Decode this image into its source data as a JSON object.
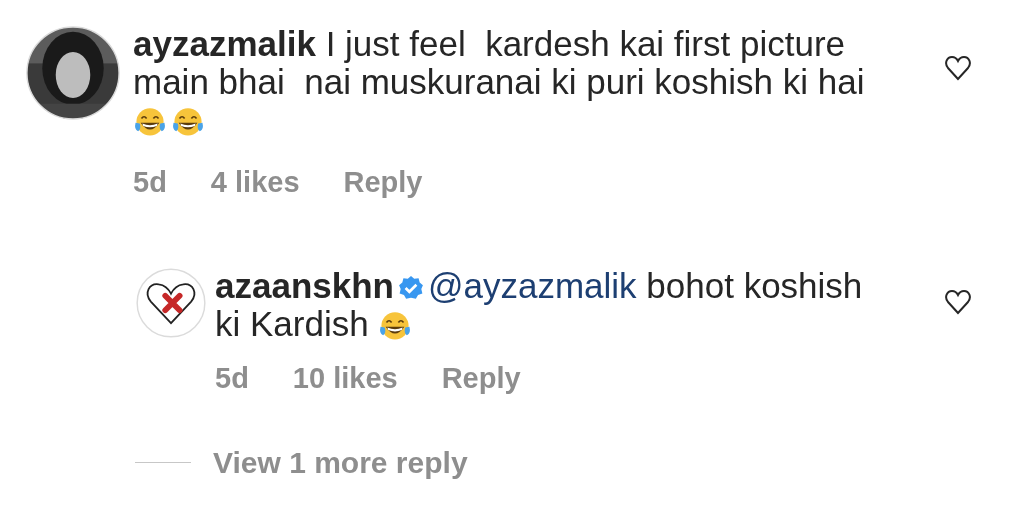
{
  "comments": [
    {
      "username": "ayzazmalik",
      "verified": false,
      "avatar": {
        "kind": "picture"
      },
      "lines": [
        "I just feel  kardesh kai first picture",
        "main bhai  nai muskuranai ki puri koshish ki hai"
      ],
      "emoji": [
        {
          "kind": "tears-of-joy"
        },
        {
          "kind": "tears-of-joy"
        }
      ],
      "emoji_inline": false,
      "liked": false,
      "age": "5d",
      "likes": "4 likes",
      "reply_label": "Reply",
      "replies": [
        {
          "username": "azaanskhn",
          "verified": true,
          "avatar": {
            "kind": "broken-heart"
          },
          "mention": "@ayzazmalik",
          "lines": [
            " bohot koshish",
            "ki Kardish"
          ],
          "emoji": [
            {
              "kind": "tears-of-joy"
            }
          ],
          "emoji_inline": true,
          "liked": false,
          "age": "5d",
          "likes": "10 likes",
          "reply_label": "Reply"
        }
      ],
      "more_replies": "View 1 more reply"
    }
  ]
}
